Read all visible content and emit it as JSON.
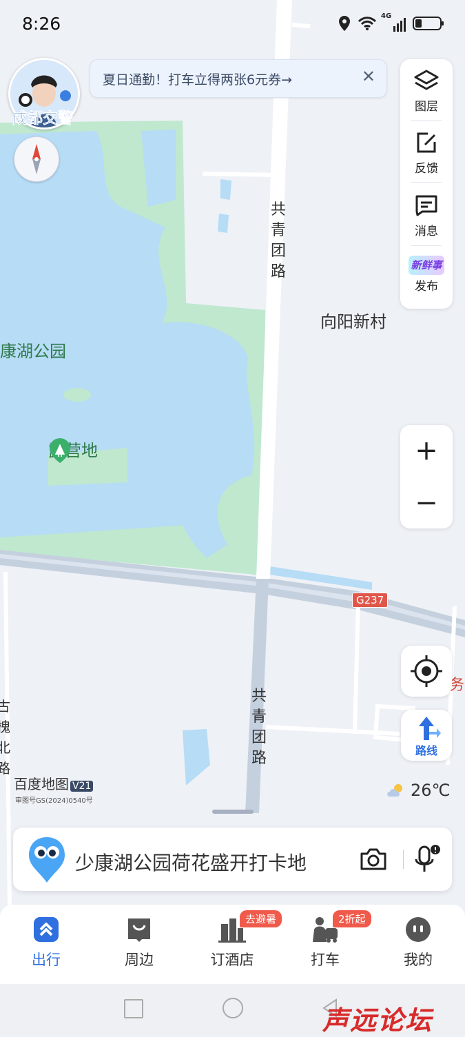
{
  "status_bar": {
    "time": "8:26",
    "network": "4G",
    "icons": [
      "location-icon",
      "wifi-icon",
      "signal-icon",
      "battery-icon"
    ]
  },
  "map": {
    "labels": {
      "park": "康湖公园",
      "campsite": "露营地",
      "village": "向阳新村",
      "road_north": "共青团路",
      "road_south": "共青团路",
      "road_left": "古槐北路",
      "highway_shield": "G237",
      "partial_right": "务"
    },
    "colors": {
      "water": "#b6dcf6",
      "park": "#bfe8cf",
      "land": "#eef1f6",
      "road": "#ffffff",
      "road_major": "#c5d0de"
    }
  },
  "police": {
    "label": "成都交警"
  },
  "banner": {
    "text": "夏日通勤！打车立得两张6元券→",
    "close": "✕"
  },
  "toolbar": {
    "layers": "图层",
    "feedback": "反馈",
    "messages": "消息",
    "publish_logo": "新鲜事",
    "publish": "发布"
  },
  "zoom": {
    "in": "+",
    "out": "−"
  },
  "route": {
    "label": "路线"
  },
  "branding": {
    "logo": "百度地图",
    "version": "V21",
    "approval": "审图号GS(2024)0540号"
  },
  "weather": {
    "temp": "26℃",
    "icon": "partly-cloudy-icon"
  },
  "search": {
    "text": "少康湖公园荷花盛开打卡地"
  },
  "bottom_nav": {
    "items": [
      {
        "label": "出行",
        "active": true
      },
      {
        "label": "周边",
        "active": false
      },
      {
        "label": "订酒店",
        "badge": "去避暑",
        "active": false
      },
      {
        "label": "打车",
        "badge": "2折起",
        "active": false
      },
      {
        "label": "我的",
        "active": false
      }
    ],
    "active_color": "#2f6fe0"
  },
  "watermark": "声远论坛"
}
